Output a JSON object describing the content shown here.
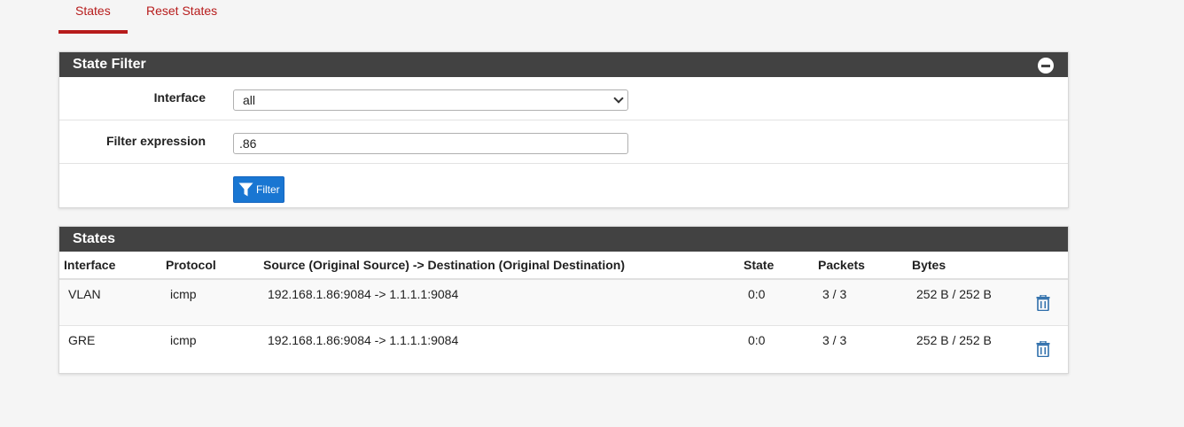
{
  "tabs": [
    {
      "label": "States",
      "active": true
    },
    {
      "label": "Reset States",
      "active": false
    }
  ],
  "filter_panel": {
    "title": "State Filter",
    "interface_label": "Interface",
    "interface_value": "all",
    "expression_label": "Filter expression",
    "expression_value": ".86",
    "filter_button": "Filter"
  },
  "states_panel": {
    "title": "States",
    "columns": [
      "Interface",
      "Protocol",
      "Source (Original Source) -> Destination (Original Destination)",
      "State",
      "Packets",
      "Bytes"
    ],
    "rows": [
      {
        "interface": "VLAN",
        "protocol": "icmp",
        "src_dst": "192.168.1.86:9084 -> 1.1.1.1:9084",
        "state": "0:0",
        "packets": "3 / 3",
        "bytes": "252 B / 252 B"
      },
      {
        "interface": "GRE",
        "protocol": "icmp",
        "src_dst": "192.168.1.86:9084 -> 1.1.1.1:9084",
        "state": "0:0",
        "packets": "3 / 3",
        "bytes": "252 B / 252 B"
      }
    ]
  },
  "colors": {
    "accent": "#b71c1c",
    "panel_heading": "#424242",
    "button": "#1976d2",
    "trash_icon": "#2f6fab"
  },
  "icons": {
    "collapse": "minus-circle-icon",
    "filter": "funnel-icon",
    "delete": "trash-icon"
  }
}
